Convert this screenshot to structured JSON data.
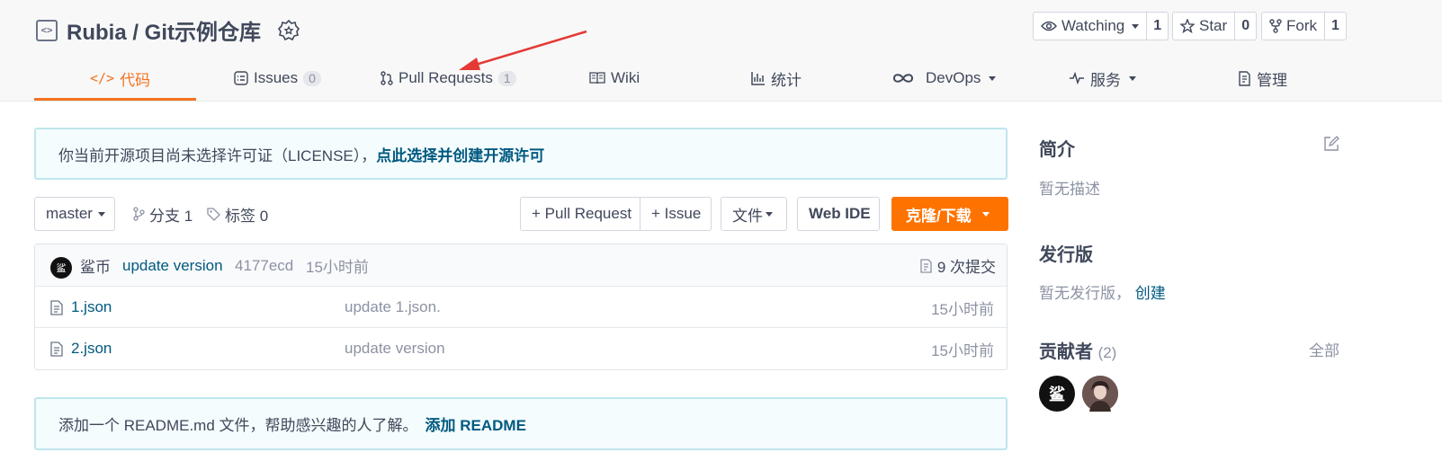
{
  "header": {
    "repo_title": "Rubia / Git示例仓库",
    "watch": {
      "label": "Watching",
      "count": "1"
    },
    "star": {
      "label": "Star",
      "count": "0"
    },
    "fork": {
      "label": "Fork",
      "count": "1"
    }
  },
  "tabs": [
    {
      "label": "代码",
      "icon": "code-icon",
      "active": true
    },
    {
      "label": "Issues",
      "count": "0",
      "icon": "issues-icon"
    },
    {
      "label": "Pull Requests",
      "count": "1",
      "icon": "pull-request-icon"
    },
    {
      "label": "Wiki",
      "icon": "book-icon"
    },
    {
      "label": "统计",
      "icon": "bar-chart-icon"
    },
    {
      "label": "DevOps",
      "icon": "infinity-icon"
    },
    {
      "label": "服务",
      "icon": "pulse-icon"
    },
    {
      "label": "管理",
      "icon": "settings-doc-icon"
    }
  ],
  "license_notice": {
    "text": "你当前开源项目尚未选择许可证（LICENSE），",
    "link": "点此选择并创建开源许可"
  },
  "toolbar": {
    "branch": "master",
    "branches": "分支 1",
    "tags": "标签 0",
    "new_pr": "+ Pull Request",
    "new_issue": "+ Issue",
    "file_menu": "文件",
    "web_ide": "Web IDE",
    "clone": "克隆/下载"
  },
  "latest_commit": {
    "avatar_text": "鲨",
    "author": "鲨币",
    "message": "update version",
    "hash": "4177ecd",
    "time": "15小时前",
    "commits": "9 次提交"
  },
  "files": [
    {
      "name": "1.json",
      "message": "update 1.json.",
      "time": "15小时前"
    },
    {
      "name": "2.json",
      "message": "update version",
      "time": "15小时前"
    }
  ],
  "readme_notice": {
    "text": "添加一个 README.md 文件，帮助感兴趣的人了解。",
    "link": "添加 README"
  },
  "sidebar": {
    "intro_title": "简介",
    "intro_text": "暂无描述",
    "release_title": "发行版",
    "release_text": "暂无发行版，",
    "release_link": "创建",
    "contrib_title": "贡献者",
    "contrib_count": "(2)",
    "contrib_all": "全部",
    "contrib_avatar_1": "鲨"
  },
  "colors": {
    "accent": "#f3731f",
    "clone_button": "#fe7300",
    "link": "#005980",
    "annotation_arrow": "#e53935"
  }
}
